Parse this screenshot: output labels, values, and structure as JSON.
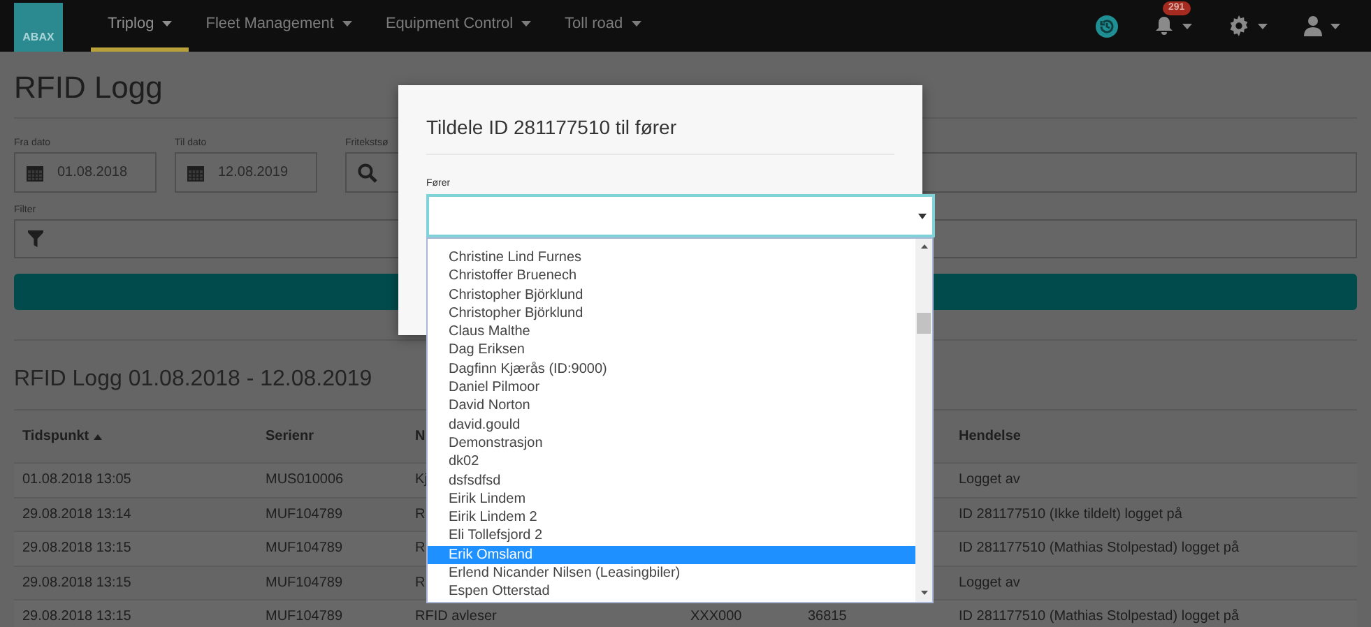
{
  "nav": {
    "logo": "ABAX",
    "items": [
      {
        "label": "Triplog",
        "selected": true
      },
      {
        "label": "Fleet Management",
        "selected": false
      },
      {
        "label": "Equipment Control",
        "selected": false
      },
      {
        "label": "Toll road",
        "selected": false
      }
    ],
    "notifications_badge": "291"
  },
  "page": {
    "title": "RFID Logg",
    "filters": [
      {
        "kind": "date",
        "label": "Fra dato",
        "value": "01.08.2018"
      },
      {
        "kind": "date",
        "label": "Til dato",
        "value": "12.08.2019"
      },
      {
        "kind": "search",
        "label": "Fritekstsø"
      }
    ],
    "filter_label": "Filter",
    "log_heading": "RFID Logg 01.08.2018 - 12.08.2019",
    "table": {
      "header": {
        "tidspunkt": "Tidspunkt",
        "sorted": true,
        "serienr": "Serienr",
        "column_3": "N",
        "hendelse": "Hendelse"
      },
      "rows": [
        {
          "tidspunkt": "01.08.2018 13:05",
          "serienr": "MUS010006",
          "column_3": "Kj",
          "hendelse": "Logget av"
        },
        {
          "tidspunkt": "29.08.2018 13:14",
          "serienr": "MUF104789",
          "column_3": "R",
          "hendelse": "ID 281177510 (Ikke tildelt) logget på"
        },
        {
          "tidspunkt": "29.08.2018 13:15",
          "serienr": "MUF104789",
          "column_3": "R",
          "hendelse": "ID 281177510 (Mathias Stolpestad) logget på"
        },
        {
          "tidspunkt": "29.08.2018 13:15",
          "serienr": "MUF104789",
          "column_3": "R",
          "hendelse": "Logget av"
        },
        {
          "tidspunkt": "29.08.2018 13:15",
          "serienr": "MUF104789",
          "column_3": "RFID avleser",
          "column_4": "XXX000",
          "column_5": "36815",
          "hendelse": "ID 281177510 (Mathias Stolpestad) logget på"
        }
      ]
    }
  },
  "modal": {
    "title": "Tildele ID 281177510 til fører",
    "field_label": "Fører",
    "options": [
      {
        "label": "Christine Lind Furnes",
        "selected": false
      },
      {
        "label": "Christoffer Bruenech",
        "selected": false
      },
      {
        "label": "Christopher Björklund",
        "selected": false
      },
      {
        "label": "Christopher Björklund",
        "selected": false
      },
      {
        "label": "Claus Malthe",
        "selected": false
      },
      {
        "label": "Dag Eriksen",
        "selected": false
      },
      {
        "label": "Dagfinn Kjærås (ID:9000)",
        "selected": false
      },
      {
        "label": "Daniel Pilmoor",
        "selected": false
      },
      {
        "label": "David Norton",
        "selected": false
      },
      {
        "label": "david.gould",
        "selected": false
      },
      {
        "label": "Demonstrasjon",
        "selected": false
      },
      {
        "label": "dk02",
        "selected": false
      },
      {
        "label": "dsfsdfsd",
        "selected": false
      },
      {
        "label": "Eirik Lindem",
        "selected": false
      },
      {
        "label": "Eirik Lindem 2",
        "selected": false
      },
      {
        "label": "Eli Tollefsjord 2",
        "selected": false
      },
      {
        "label": "Erik Omsland",
        "selected": true
      },
      {
        "label": "Erlend Nicander Nilsen (Leasingbiler)",
        "selected": false
      },
      {
        "label": "Espen Otterstad",
        "selected": false
      }
    ]
  }
}
